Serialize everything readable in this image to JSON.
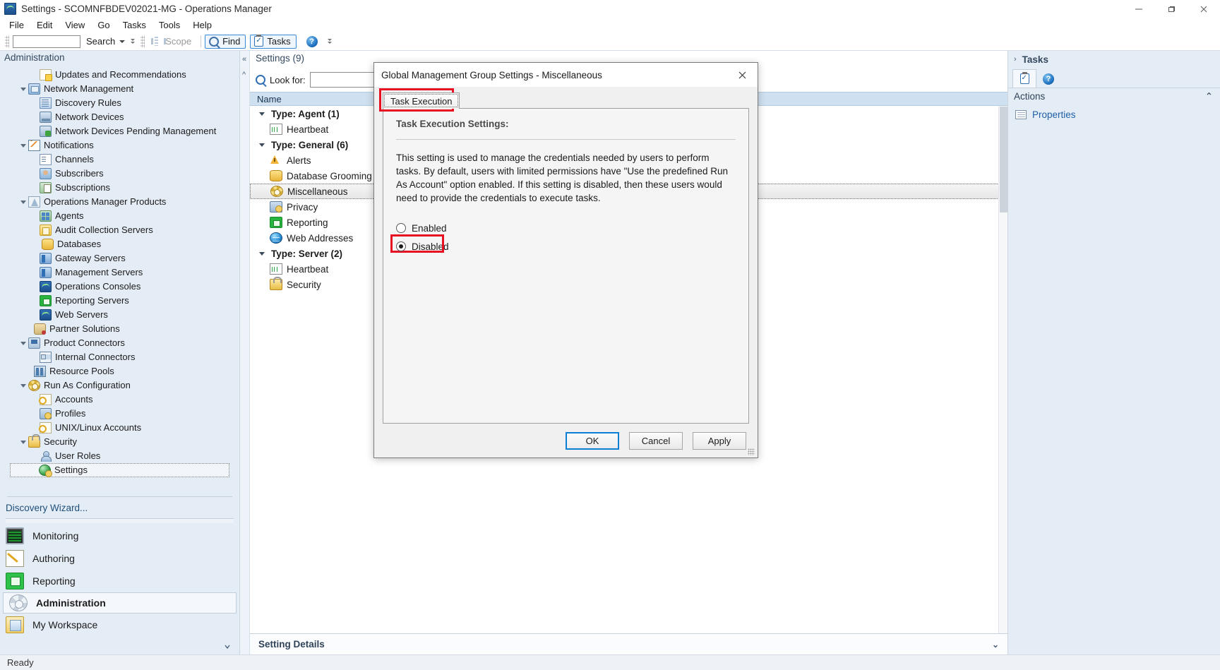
{
  "window": {
    "title": "Settings - SCOMNFBDEV02021-MG - Operations Manager",
    "app_icon": "operations-console-icon",
    "minimize": "—",
    "maximize": "❐",
    "close": "✕"
  },
  "menu": {
    "items": [
      "File",
      "Edit",
      "View",
      "Go",
      "Tasks",
      "Tools",
      "Help"
    ]
  },
  "toolbar": {
    "search_value": "",
    "search_label": "Search",
    "scope_label": "Scope",
    "find_label": "Find",
    "tasks_label": "Tasks",
    "help_label": "?"
  },
  "left_pane": {
    "header": "Administration",
    "tree": [
      {
        "label": "Updates and Recommendations",
        "indent": 2,
        "twisty": false,
        "icon": "updates-icon"
      },
      {
        "label": "Network Management",
        "indent": 1,
        "twisty": true,
        "icon": "network-management-icon"
      },
      {
        "label": "Discovery Rules",
        "indent": 2,
        "twisty": false,
        "icon": "discovery-rules-icon"
      },
      {
        "label": "Network Devices",
        "indent": 2,
        "twisty": false,
        "icon": "network-devices-icon"
      },
      {
        "label": "Network Devices Pending Management",
        "indent": 2,
        "twisty": false,
        "icon": "network-devices-pending-icon"
      },
      {
        "label": "Notifications",
        "indent": 1,
        "twisty": true,
        "icon": "notifications-icon"
      },
      {
        "label": "Channels",
        "indent": 2,
        "twisty": false,
        "icon": "channels-icon"
      },
      {
        "label": "Subscribers",
        "indent": 2,
        "twisty": false,
        "icon": "subscribers-icon"
      },
      {
        "label": "Subscriptions",
        "indent": 2,
        "twisty": false,
        "icon": "subscriptions-icon"
      },
      {
        "label": "Operations Manager Products",
        "indent": 1,
        "twisty": true,
        "icon": "products-icon"
      },
      {
        "label": "Agents",
        "indent": 2,
        "twisty": false,
        "icon": "agents-icon"
      },
      {
        "label": "Audit Collection Servers",
        "indent": 2,
        "twisty": false,
        "icon": "audit-collection-icon"
      },
      {
        "label": "Databases",
        "indent": 2,
        "twisty": false,
        "icon": "databases-icon"
      },
      {
        "label": "Gateway Servers",
        "indent": 2,
        "twisty": false,
        "icon": "gateway-servers-icon"
      },
      {
        "label": "Management Servers",
        "indent": 2,
        "twisty": false,
        "icon": "management-servers-icon"
      },
      {
        "label": "Operations Consoles",
        "indent": 2,
        "twisty": false,
        "icon": "operations-consoles-icon"
      },
      {
        "label": "Reporting Servers",
        "indent": 2,
        "twisty": false,
        "icon": "reporting-servers-icon"
      },
      {
        "label": "Web Servers",
        "indent": 2,
        "twisty": false,
        "icon": "web-servers-icon"
      },
      {
        "label": "Partner Solutions",
        "indent": 1.5,
        "twisty": false,
        "icon": "partner-solutions-icon"
      },
      {
        "label": "Product Connectors",
        "indent": 1,
        "twisty": true,
        "icon": "product-connectors-icon"
      },
      {
        "label": "Internal Connectors",
        "indent": 2,
        "twisty": false,
        "icon": "internal-connectors-icon"
      },
      {
        "label": "Resource Pools",
        "indent": 1.5,
        "twisty": false,
        "icon": "resource-pools-icon"
      },
      {
        "label": "Run As Configuration",
        "indent": 1,
        "twisty": true,
        "icon": "run-as-configuration-icon"
      },
      {
        "label": "Accounts",
        "indent": 2,
        "twisty": false,
        "icon": "accounts-icon"
      },
      {
        "label": "Profiles",
        "indent": 2,
        "twisty": false,
        "icon": "profiles-icon"
      },
      {
        "label": "UNIX/Linux Accounts",
        "indent": 2,
        "twisty": false,
        "icon": "unix-linux-accounts-icon"
      },
      {
        "label": "Security",
        "indent": 1,
        "twisty": true,
        "icon": "security-icon"
      },
      {
        "label": "User Roles",
        "indent": 2,
        "twisty": false,
        "icon": "user-roles-icon"
      },
      {
        "label": "Settings",
        "indent": 2,
        "twisty": false,
        "icon": "settings-icon",
        "selected": true
      }
    ],
    "wizard_link": "Discovery Wizard...",
    "nav": [
      {
        "label": "Monitoring",
        "icon": "monitoring-icon",
        "active": false
      },
      {
        "label": "Authoring",
        "icon": "authoring-icon",
        "active": false
      },
      {
        "label": "Reporting",
        "icon": "reporting-icon",
        "active": false
      },
      {
        "label": "Administration",
        "icon": "administration-icon",
        "active": true
      },
      {
        "label": "My Workspace",
        "icon": "my-workspace-icon",
        "active": false
      }
    ]
  },
  "center_pane": {
    "title": "Settings (9)",
    "look_for_label": "Look for:",
    "look_for_value": "",
    "look_for_placeholder": "",
    "column_header": "Name",
    "rows": [
      {
        "label": "Type: Agent (1)",
        "group": true
      },
      {
        "label": "Heartbeat",
        "group": false,
        "icon": "heartbeat-icon"
      },
      {
        "label": "Type: General (6)",
        "group": true
      },
      {
        "label": "Alerts",
        "group": false,
        "icon": "alerts-icon"
      },
      {
        "label": "Database Grooming",
        "group": false,
        "icon": "database-grooming-icon"
      },
      {
        "label": "Miscellaneous",
        "group": false,
        "icon": "miscellaneous-icon",
        "selected": true
      },
      {
        "label": "Privacy",
        "group": false,
        "icon": "privacy-icon"
      },
      {
        "label": "Reporting",
        "group": false,
        "icon": "reporting-icon"
      },
      {
        "label": "Web Addresses",
        "group": false,
        "icon": "web-addresses-icon"
      },
      {
        "label": "Type: Server (2)",
        "group": true
      },
      {
        "label": "Heartbeat",
        "group": false,
        "icon": "heartbeat-icon"
      },
      {
        "label": "Security",
        "group": false,
        "icon": "security-icon"
      }
    ],
    "details_bar": "Setting Details",
    "details_caret": "⌄"
  },
  "right_pane": {
    "title": "Tasks",
    "chevron": "›",
    "tabs": [
      {
        "name": "tasks-tab",
        "icon": "clipboard-icon",
        "active": true
      },
      {
        "name": "help-tab",
        "icon": "help-icon",
        "active": false
      }
    ],
    "actions_header": "Actions",
    "actions_caret": "⌃",
    "actions": [
      {
        "label": "Properties",
        "icon": "properties-icon"
      }
    ]
  },
  "dialog": {
    "title": "Global Management Group Settings - Miscellaneous",
    "close": "✕",
    "tabs": [
      {
        "label": "Task Execution",
        "active": true,
        "highlighted": true
      }
    ],
    "panel_heading": "Task Execution Settings:",
    "description": "This setting is used to manage the credentials needed by users to perform tasks. By default, users with limited permissions have \"Use the predefined Run As Account\" option enabled. If this setting is disabled, then these users would need to provide the credentials to execute tasks.",
    "radios": [
      {
        "label": "Enabled",
        "selected": false,
        "highlighted": false
      },
      {
        "label": "Disabled",
        "selected": true,
        "highlighted": true
      }
    ],
    "buttons": [
      {
        "label": "OK",
        "default": true
      },
      {
        "label": "Cancel",
        "default": false
      },
      {
        "label": "Apply",
        "default": false
      }
    ]
  },
  "status_bar": {
    "text": "Ready"
  },
  "colors": {
    "highlight_red": "#e81123",
    "accent_blue": "#1f5fa8",
    "pane_bg": "#e4ecf5",
    "header_blue": "#cfe0f0"
  }
}
